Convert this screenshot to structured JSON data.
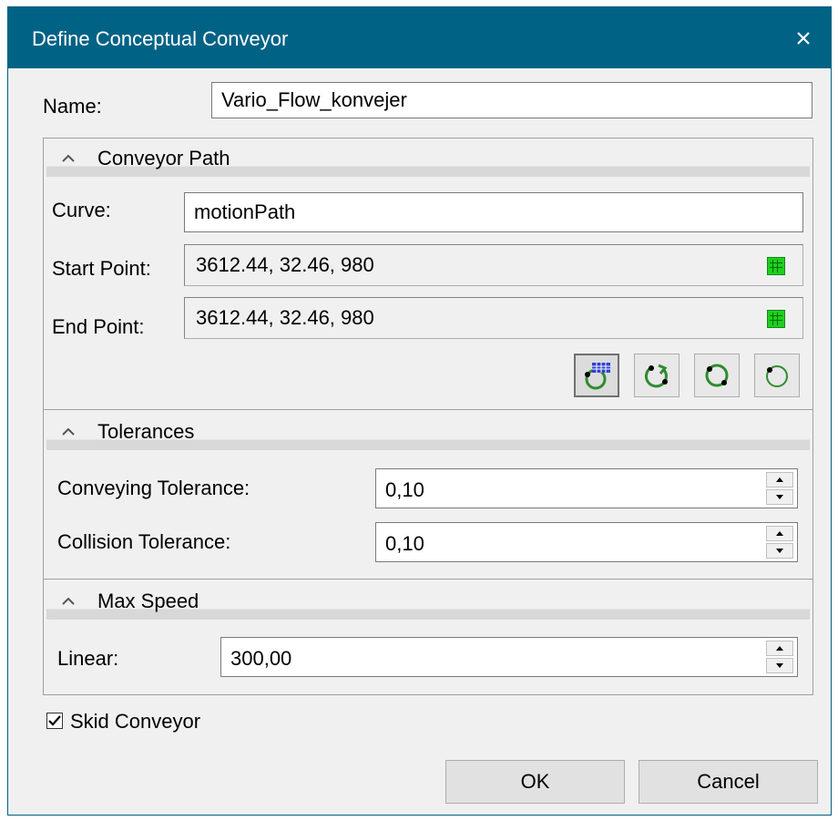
{
  "window": {
    "title": "Define Conceptual Conveyor"
  },
  "name_row": {
    "label": "Name:",
    "value": "Vario_Flow_konvejer"
  },
  "conveyor_path": {
    "title": "Conveyor Path",
    "curve_label": "Curve:",
    "curve_value": "motionPath",
    "start_label": "Start Point:",
    "start_value": "3612.44, 32.46, 980",
    "end_label": "End Point:",
    "end_value": "3612.44, 32.46, 980",
    "tools": [
      "path-table-icon",
      "circle-direction-icon",
      "circle-closed-icon",
      "circle-open-icon"
    ]
  },
  "tolerances": {
    "title": "Tolerances",
    "conveying_label": "Conveying Tolerance:",
    "conveying_value": "0,10",
    "collision_label": "Collision Tolerance:",
    "collision_value": "0,10"
  },
  "max_speed": {
    "title": "Max Speed",
    "linear_label": "Linear:",
    "linear_value": "300,00"
  },
  "skid": {
    "label": "Skid Conveyor",
    "checked": true
  },
  "buttons": {
    "ok": "OK",
    "cancel": "Cancel"
  },
  "colors": {
    "titlebar": "#006285",
    "pick_green": "#1ecf1e"
  }
}
